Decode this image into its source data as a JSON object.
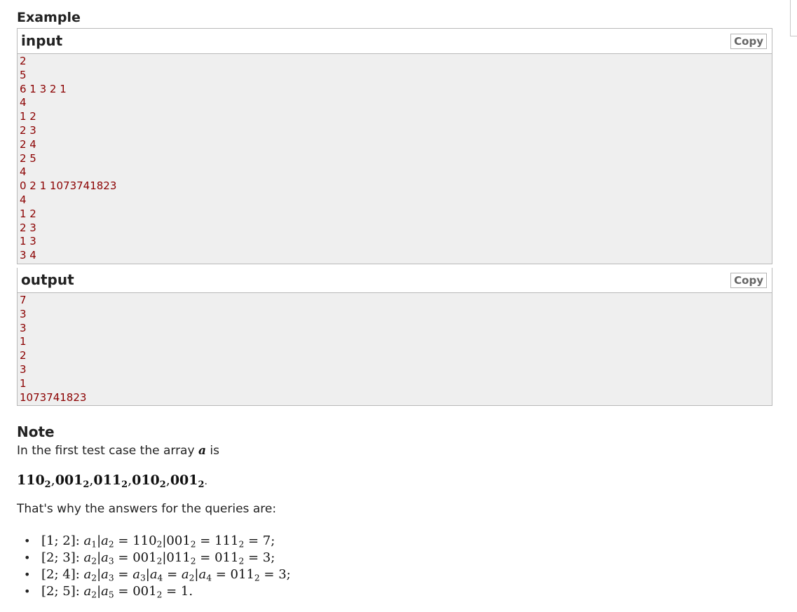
{
  "example": {
    "title": "Example",
    "input": {
      "label": "input",
      "copy_label": "Copy",
      "lines": [
        "2",
        "5",
        "6 1 3 2 1",
        "4",
        "1 2",
        "2 3",
        "2 4",
        "2 5",
        "4",
        "0 2 1 1073741823",
        "4",
        "1 2",
        "2 3",
        "1 3",
        "3 4"
      ]
    },
    "output": {
      "label": "output",
      "copy_label": "Copy",
      "lines": [
        "7",
        "3",
        "3",
        "1",
        "2",
        "3",
        "1",
        "1073741823"
      ]
    }
  },
  "note": {
    "title": "Note",
    "intro_before": "In the first test case the array ",
    "intro_var": "a",
    "intro_after": " is",
    "binary_values": [
      {
        "v": "110",
        "s": "2"
      },
      {
        "v": "001",
        "s": "2"
      },
      {
        "v": "011",
        "s": "2"
      },
      {
        "v": "010",
        "s": "2"
      },
      {
        "v": "001",
        "s": "2"
      }
    ],
    "why": "That's why the answers for the queries are:",
    "queries": [
      "[1; 2]: a₁|a₂ = 110₂|001₂ = 111₂ = 7;",
      "[2; 3]: a₂|a₃ = 001₂|011₂ = 011₂ = 3;",
      "[2; 4]: a₂|a₃ = a₃|a₄ = a₂|a₄ = 011₂ = 3;",
      "[2; 5]: a₂|a₅ = 001₂ = 1."
    ]
  }
}
